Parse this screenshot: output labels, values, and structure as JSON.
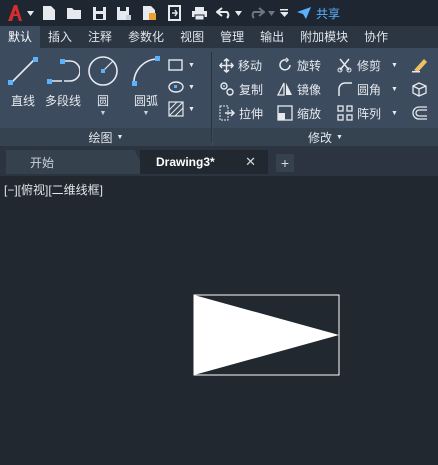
{
  "app": {
    "share_label": "共享"
  },
  "ribbon_tabs": [
    "默认",
    "插入",
    "注释",
    "参数化",
    "视图",
    "管理",
    "输出",
    "附加模块",
    "协作"
  ],
  "draw_panel": {
    "title": "绘图",
    "tools": {
      "line": "直线",
      "polyline": "多段线",
      "circle": "圆",
      "arc": "圆弧"
    }
  },
  "modify_panel": {
    "title": "修改",
    "tools": {
      "move": "移动",
      "rotate": "旋转",
      "trim": "修剪",
      "copy": "复制",
      "mirror": "镜像",
      "fillet": "圆角",
      "stretch": "拉伸",
      "scale": "缩放",
      "array": "阵列"
    }
  },
  "doc_tabs": {
    "start": "开始",
    "active": "Drawing3*"
  },
  "viewport": {
    "label": "[−][俯视][二维线框]"
  },
  "colors": {
    "accent": "#5ab2ff",
    "logo_red": "#d62d2d",
    "canvas": "#212830",
    "ribbon": "#3c4b5e"
  }
}
